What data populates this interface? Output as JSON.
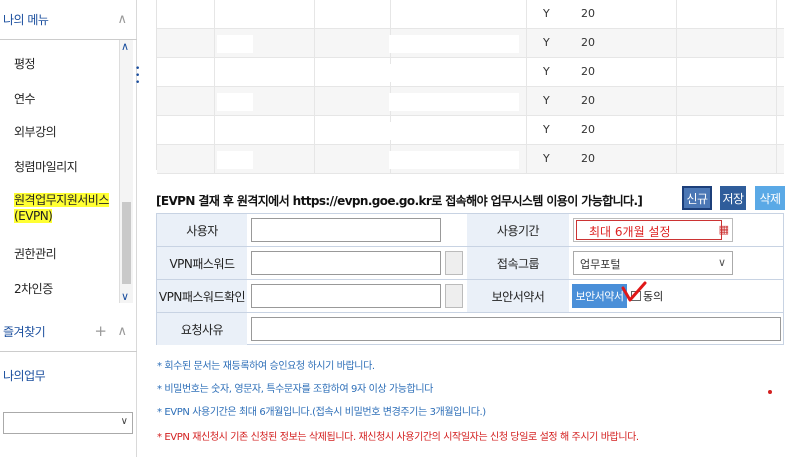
{
  "sidebar": {
    "my_menu_title": "나의 메뉴",
    "items": [
      {
        "label": "평정"
      },
      {
        "label": "연수"
      },
      {
        "label": "외부강의"
      },
      {
        "label": "청렴마일리지"
      },
      {
        "label": "원격업무지원서비스(EVPN)",
        "active": true
      },
      {
        "label": "권한관리"
      },
      {
        "label": "2차인증"
      }
    ],
    "favorites_title": "즐겨찾기",
    "my_work_title": "나의업무",
    "select_value": ""
  },
  "table": {
    "rows": [
      {
        "flag": "Y",
        "date": "20"
      },
      {
        "flag": "Y",
        "date": "20"
      },
      {
        "flag": "Y",
        "date": "20"
      },
      {
        "flag": "Y",
        "date": "20"
      },
      {
        "flag": "Y",
        "date": "20"
      },
      {
        "flag": "Y",
        "date": "20"
      }
    ]
  },
  "notice": "[EVPN 결재 후 원격지에서 https://evpn.goe.go.kr로 접속해야 업무시스템 이용이 가능합니다.]",
  "buttons": {
    "new": "신규",
    "save": "저장",
    "delete": "삭제"
  },
  "form": {
    "user_label": "사용자",
    "user_value": "",
    "period_label": "사용기간",
    "period_overlay": "최대 6개월 설정",
    "vpn_pw_label": "VPN패스워드",
    "vpn_pw_value": "",
    "group_label": "접속그룹",
    "group_value": "업무포털",
    "vpn_pw_confirm_label": "VPN패스워드확인",
    "vpn_pw_confirm_value": "",
    "security_label": "보안서약서",
    "security_button": "보안서약서",
    "agree_label": "동의",
    "reason_label": "요청사유",
    "reason_value": ""
  },
  "notes": [
    {
      "text": "* 회수된 문서는 재등록하여 승인요청 하시기 바랍니다.",
      "color": "blue"
    },
    {
      "text": "* 비밀번호는 숫자, 영문자, 특수문자를 조합하여 9자 이상 가능합니다",
      "color": "blue"
    },
    {
      "text": "* EVPN 사용기간은 최대 6개월입니다.(접속시 비밀번호 변경주기는 3개월입니다.)",
      "color": "blue"
    },
    {
      "text": "* EVPN 재신청시 기존 신청된 정보는 삭제됩니다. 재신청시 사용기간의 시작일자는 신청 당일로 설정 해 주시기 바랍니다.",
      "color": "red"
    }
  ],
  "colors": {
    "accent": "#2f5d9b",
    "highlight": "#ffff33",
    "warning": "#d32020",
    "info": "#2e6fb8"
  }
}
